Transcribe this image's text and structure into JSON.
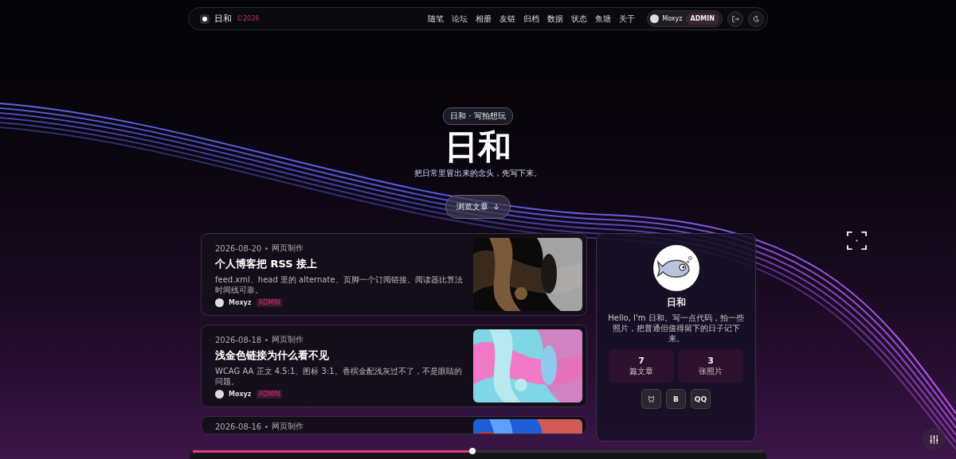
{
  "nav": {
    "brand": "日和",
    "badge": "©2026",
    "links": [
      "随笔",
      "论坛",
      "相册",
      "友链",
      "归档",
      "数据",
      "状态",
      "鱼塘",
      "关于"
    ],
    "user": {
      "name": "Moxyz",
      "role": "ADMIN"
    }
  },
  "hero": {
    "tag": "日和 · 写拍想玩",
    "title": "日和",
    "subtitle": "把日常里冒出来的念头，先写下来。",
    "button": "浏览文章"
  },
  "posts": [
    {
      "date": "2026-08-20",
      "category": "网页制作",
      "title": "个人博客把 RSS 接上",
      "excerpt": "feed.xml、head 里的 alternate、页脚一个订阅链接。阅读器比算法时间线可靠。",
      "author": "Moxyz",
      "role": "ADMIN"
    },
    {
      "date": "2026-08-18",
      "category": "网页制作",
      "title": "浅金色链接为什么看不见",
      "excerpt": "WCAG AA 正文 4.5:1、图标 3:1。香槟金配浅灰过不了，不是眼睛的问题。",
      "author": "Moxyz",
      "role": "ADMIN"
    },
    {
      "date": "2026-08-16",
      "category": "网页制作"
    }
  ],
  "profile": {
    "name": "日和",
    "bio": "Hello, I'm 日和。写一点代码，拍一些照片，把普通但值得留下的日子记下来。",
    "stats": [
      {
        "value": "7",
        "label": "篇文章"
      },
      {
        "value": "3",
        "label": "张照片"
      }
    ],
    "socials": [
      {
        "kind": "icon"
      },
      {
        "kind": "text",
        "label": "B"
      },
      {
        "kind": "text",
        "label": "QQ"
      }
    ]
  },
  "player": {
    "level": 0.49
  }
}
